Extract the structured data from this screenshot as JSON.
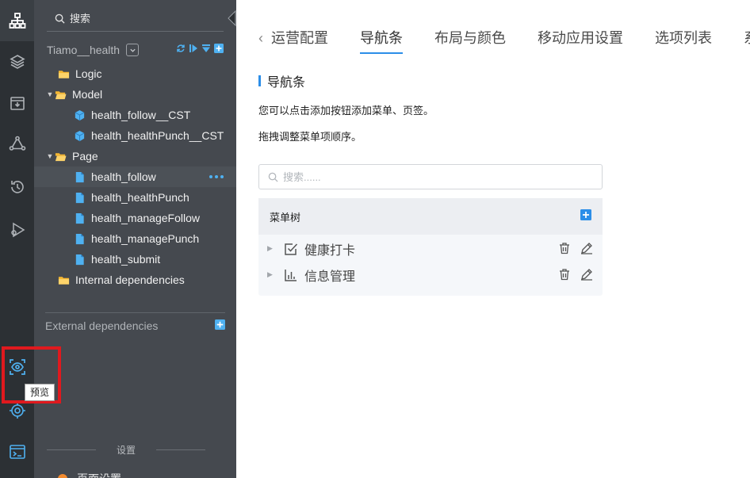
{
  "explorer": {
    "search_placeholder": "搜索",
    "project_name": "Tiamo__health",
    "tree": {
      "logic": "Logic",
      "model": "Model",
      "model_items": [
        "health_follow__CST",
        "health_healthPunch__CST"
      ],
      "page": "Page",
      "page_items": [
        "health_follow",
        "health_healthPunch",
        "health_manageFollow",
        "health_managePunch",
        "health_submit"
      ],
      "internal": "Internal dependencies"
    },
    "external": "External dependencies",
    "settings": "设置",
    "page_settings": "页面设置"
  },
  "activity": {
    "tooltip": "预览"
  },
  "main": {
    "tabs": [
      "运营配置",
      "导航条",
      "布局与颜色",
      "移动应用设置",
      "选项列表",
      "系统"
    ],
    "active_tab_index": 1,
    "section_title": "导航条",
    "hint1": "您可以点击添加按钮添加菜单、页签。",
    "hint2": "拖拽调整菜单项顺序。",
    "search_placeholder": "搜索......",
    "menu_tree_title": "菜单树",
    "menu_items": [
      "健康打卡",
      "信息管理"
    ]
  },
  "colors": {
    "accent": "#2c8ee8",
    "highlight_box": "#e0191e",
    "sidebar_bg": "#2c3034",
    "explorer_bg": "#45494f",
    "folder": "#f7b731",
    "file": "#4fb1f1"
  },
  "icons": {
    "activity": [
      "org-chart-icon",
      "layers-icon",
      "inbox-icon",
      "network-icon",
      "history-icon",
      "deploy-icon",
      "preview-eye-icon",
      "target-icon",
      "terminal-icon"
    ]
  }
}
